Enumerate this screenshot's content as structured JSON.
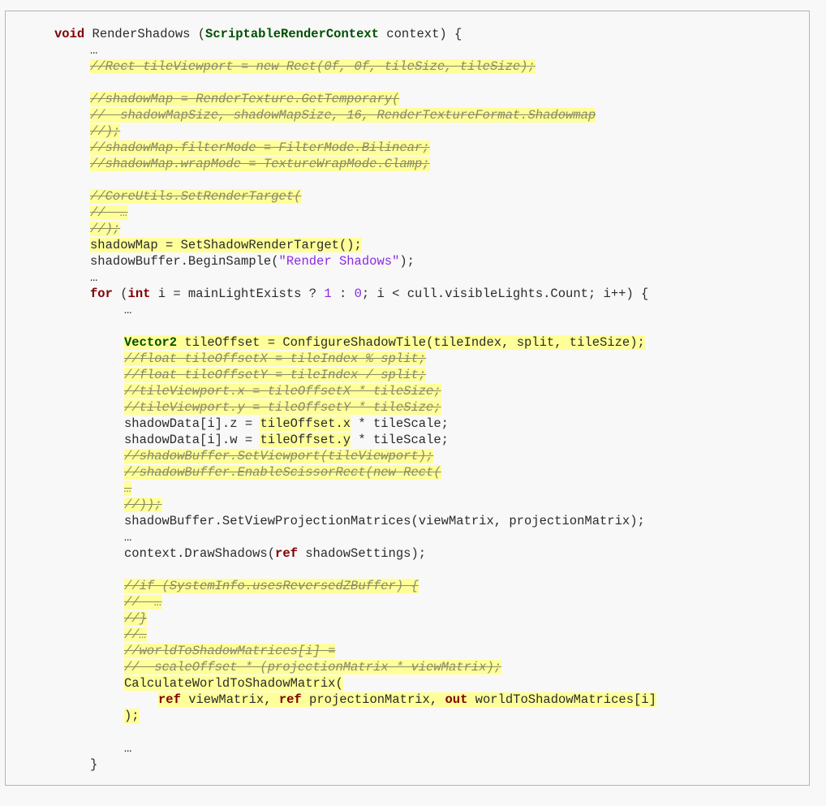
{
  "code_lines": [
    {
      "text": "void RenderShadows (ScriptableRenderContext context) {",
      "segments": [
        {
          "t": "void",
          "c": "kw"
        },
        {
          "t": " RenderShadows ("
        },
        {
          "t": "ScriptableRenderContext",
          "c": "typ"
        },
        {
          "t": " context) {"
        }
      ]
    },
    {
      "text": "…",
      "segments": [
        {
          "t": "…"
        }
      ]
    },
    {
      "text": "//Rect tileViewport = new Rect(0f, 0f, tileSize, tileSize);",
      "segments": [
        {
          "t": "//Rect tileViewport = new Rect(0f, 0f, tileSize, tileSize);",
          "c": "cmt struck hl"
        }
      ]
    },
    {
      "text": "",
      "segments": []
    },
    {
      "text": "//shadowMap = RenderTexture.GetTemporary(",
      "segments": [
        {
          "t": "//shadowMap = RenderTexture.GetTemporary(",
          "c": "cmt struck hl"
        }
      ]
    },
    {
      "text": "//  shadowMapSize, shadowMapSize, 16, RenderTextureFormat.Shadowmap",
      "segments": [
        {
          "t": "//  shadowMapSize, shadowMapSize, 16, RenderTextureFormat.Shadowmap",
          "c": "cmt struck hl"
        }
      ]
    },
    {
      "text": "//);",
      "segments": [
        {
          "t": "//);",
          "c": "cmt struck hl"
        }
      ]
    },
    {
      "text": "//shadowMap.filterMode = FilterMode.Bilinear;",
      "segments": [
        {
          "t": "//shadowMap.filterMode = FilterMode.Bilinear;",
          "c": "cmt struck hl"
        }
      ]
    },
    {
      "text": "//shadowMap.wrapMode = TextureWrapMode.Clamp;",
      "segments": [
        {
          "t": "//shadowMap.wrapMode = TextureWrapMode.Clamp;",
          "c": "cmt struck hl"
        }
      ]
    },
    {
      "text": "",
      "segments": []
    },
    {
      "text": "//CoreUtils.SetRenderTarget(",
      "segments": [
        {
          "t": "//CoreUtils.SetRenderTarget(",
          "c": "cmt struck hl"
        }
      ]
    },
    {
      "text": "//  …",
      "segments": [
        {
          "t": "//  …",
          "c": "cmt struck hl"
        }
      ]
    },
    {
      "text": "//);",
      "segments": [
        {
          "t": "//);",
          "c": "cmt struck hl"
        }
      ]
    },
    {
      "text": "shadowMap = SetShadowRenderTarget();",
      "segments": [
        {
          "t": "shadowMap = SetShadowRenderTarget();",
          "c": "hl"
        }
      ]
    },
    {
      "text": "shadowBuffer.BeginSample(\"Render Shadows\");",
      "segments": [
        {
          "t": "shadowBuffer.BeginSample("
        },
        {
          "t": "\"Render Shadows\"",
          "c": "strv"
        },
        {
          "t": ");"
        }
      ]
    },
    {
      "text": "…",
      "segments": [
        {
          "t": "…"
        }
      ]
    },
    {
      "text": "for (int i = mainLightExists ? 1 : 0; i < cull.visibleLights.Count; i++) {",
      "segments": [
        {
          "t": "for",
          "c": "kw"
        },
        {
          "t": " ("
        },
        {
          "t": "int",
          "c": "kw"
        },
        {
          "t": " i = mainLightExists ? "
        },
        {
          "t": "1",
          "c": "num"
        },
        {
          "t": " : "
        },
        {
          "t": "0",
          "c": "num"
        },
        {
          "t": "; i < cull.visibleLights.Count; i++) {"
        }
      ]
    },
    {
      "text": "…",
      "segments": [
        {
          "t": "…"
        }
      ]
    },
    {
      "text": "",
      "segments": []
    },
    {
      "text": "Vector2 tileOffset = ConfigureShadowTile(tileIndex, split, tileSize);",
      "segments": [
        {
          "t": "Vector2",
          "c": "typ hl"
        },
        {
          "t": " tileOffset = ConfigureShadowTile(tileIndex, split, tileSize);",
          "c": "hl"
        }
      ]
    },
    {
      "text": "//float tileOffsetX = tileIndex % split;",
      "segments": [
        {
          "t": "//float tileOffsetX = tileIndex % split;",
          "c": "cmt struck hl"
        }
      ]
    },
    {
      "text": "//float tileOffsetY = tileIndex / split;",
      "segments": [
        {
          "t": "//float tileOffsetY = tileIndex / split;",
          "c": "cmt struck hl"
        }
      ]
    },
    {
      "text": "//tileViewport.x = tileOffsetX * tileSize;",
      "segments": [
        {
          "t": "//tileViewport.x = tileOffsetX * tileSize;",
          "c": "cmt struck hl"
        }
      ]
    },
    {
      "text": "//tileViewport.y = tileOffsetY * tileSize;",
      "segments": [
        {
          "t": "//tileViewport.y = tileOffsetY * tileSize;",
          "c": "cmt struck hl"
        }
      ]
    },
    {
      "text": "shadowData[i].z = tileOffset.x * tileScale;",
      "segments": [
        {
          "t": "shadowData[i].z = "
        },
        {
          "t": "tileOffset.x",
          "c": "hl"
        },
        {
          "t": " * tileScale;"
        }
      ]
    },
    {
      "text": "shadowData[i].w = tileOffset.y * tileScale;",
      "segments": [
        {
          "t": "shadowData[i].w = "
        },
        {
          "t": "tileOffset.y",
          "c": "hl"
        },
        {
          "t": " * tileScale;"
        }
      ]
    },
    {
      "text": "//shadowBuffer.SetViewport(tileViewport);",
      "segments": [
        {
          "t": "//shadowBuffer.SetViewport(tileViewport);",
          "c": "cmt struck hl"
        }
      ]
    },
    {
      "text": "//shadowBuffer.EnableScissorRect(new Rect(",
      "segments": [
        {
          "t": "//shadowBuffer.EnableScissorRect(new Rect(",
          "c": "cmt struck hl"
        }
      ]
    },
    {
      "text": "…",
      "segments": [
        {
          "t": "…",
          "c": "cmt struck hl"
        }
      ]
    },
    {
      "text": "//));",
      "segments": [
        {
          "t": "//));",
          "c": "cmt struck hl"
        }
      ]
    },
    {
      "text": "shadowBuffer.SetViewProjectionMatrices(viewMatrix, projectionMatrix);",
      "segments": [
        {
          "t": "shadowBuffer.SetViewProjectionMatrices(viewMatrix, projectionMatrix);"
        }
      ]
    },
    {
      "text": "…",
      "segments": [
        {
          "t": "…"
        }
      ]
    },
    {
      "text": "context.DrawShadows(ref shadowSettings);",
      "segments": [
        {
          "t": "context.DrawShadows("
        },
        {
          "t": "ref",
          "c": "kw"
        },
        {
          "t": " shadowSettings);"
        }
      ]
    },
    {
      "text": "",
      "segments": []
    },
    {
      "text": "//if (SystemInfo.usesReversedZBuffer) {",
      "segments": [
        {
          "t": "//if (SystemInfo.usesReversedZBuffer) {",
          "c": "cmt struck hl"
        }
      ]
    },
    {
      "text": "//  …",
      "segments": [
        {
          "t": "//  …",
          "c": "cmt struck hl"
        }
      ]
    },
    {
      "text": "//}",
      "segments": [
        {
          "t": "//}",
          "c": "cmt struck hl"
        }
      ]
    },
    {
      "text": "//…",
      "segments": [
        {
          "t": "//…",
          "c": "cmt struck hl"
        }
      ]
    },
    {
      "text": "//worldToShadowMatrices[i] =",
      "segments": [
        {
          "t": "//worldToShadowMatrices[i] =",
          "c": "cmt struck hl"
        }
      ]
    },
    {
      "text": "//  scaleOffset * (projectionMatrix * viewMatrix);",
      "segments": [
        {
          "t": "//  scaleOffset * (projectionMatrix * viewMatrix);",
          "c": "cmt struck hl"
        }
      ]
    },
    {
      "text": "CalculateWorldToShadowMatrix(",
      "segments": [
        {
          "t": "CalculateWorldToShadowMatrix(",
          "c": "hl"
        }
      ]
    },
    {
      "text": "ref viewMatrix, ref projectionMatrix, out worldToShadowMatrices[i]",
      "segments": [
        {
          "t": "ref",
          "c": "kw hl"
        },
        {
          "t": " viewMatrix, ",
          "c": "hl"
        },
        {
          "t": "ref",
          "c": "kw hl"
        },
        {
          "t": " projectionMatrix, ",
          "c": "hl"
        },
        {
          "t": "out",
          "c": "kw hl"
        },
        {
          "t": " worldToShadowMatrices[i]",
          "c": "hl"
        }
      ]
    },
    {
      "text": ");",
      "segments": [
        {
          "t": ");",
          "c": "hl"
        }
      ]
    },
    {
      "text": "",
      "segments": []
    },
    {
      "text": "…",
      "segments": [
        {
          "t": "…"
        }
      ]
    },
    {
      "text": "}",
      "segments": [
        {
          "t": "}"
        }
      ]
    }
  ]
}
